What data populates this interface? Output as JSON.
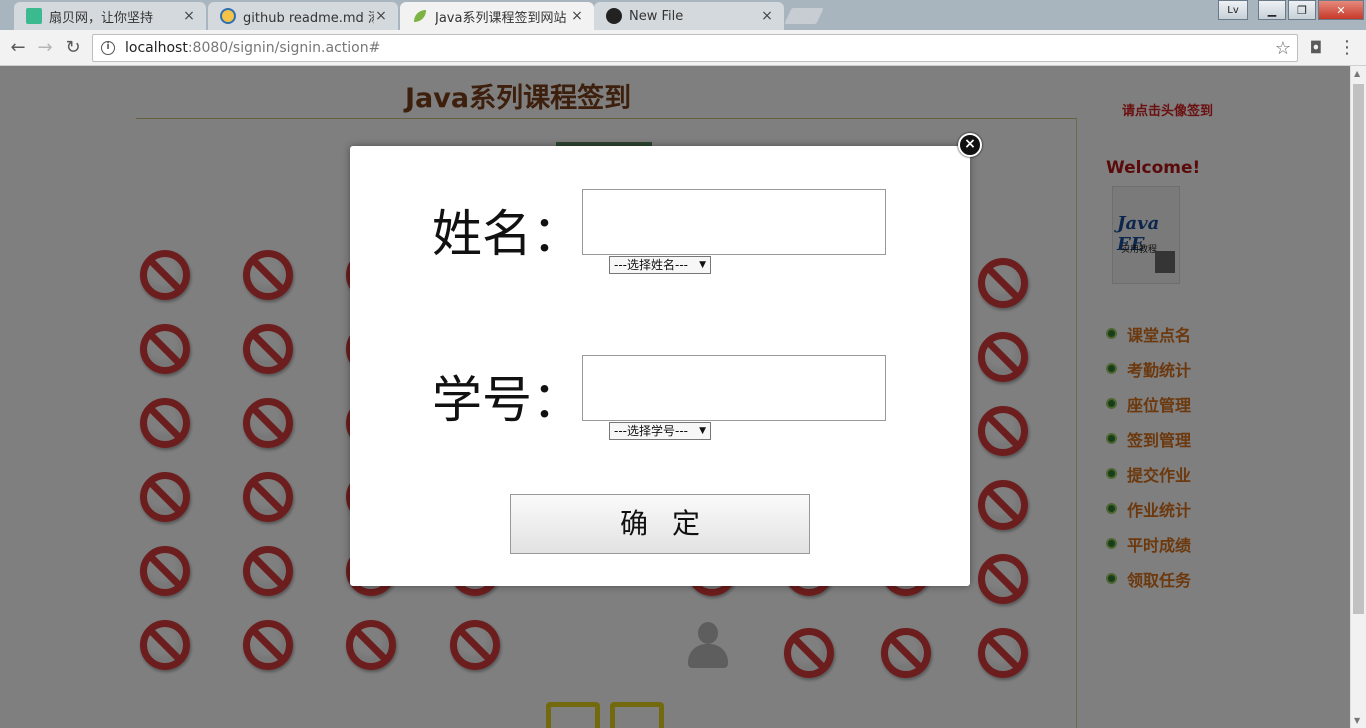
{
  "browser": {
    "tabs": [
      {
        "title": "扇贝网，让你坚持",
        "close": "×"
      },
      {
        "title": "github readme.md 添加",
        "close": "×"
      },
      {
        "title": "Java系列课程签到网站",
        "close": "×"
      },
      {
        "title": "New File",
        "close": "×"
      }
    ],
    "user_badge": "Lv",
    "url_host": "localhost",
    "url_path": ":8080/signin/signin.action#"
  },
  "page": {
    "title": "Java系列课程签到",
    "hint": "请点击头像签到",
    "welcome": "Welcome!",
    "book": {
      "title": "Java EE",
      "subtitle": "实用教程"
    },
    "menu": [
      "课堂点名",
      "考勤统计",
      "座位管理",
      "签到管理",
      "提交作业",
      "作业统计",
      "平时成绩",
      "领取任务"
    ]
  },
  "modal": {
    "name_label": "姓名：",
    "name_value": "",
    "name_select": "---选择姓名---",
    "id_label": "学号：",
    "id_value": "",
    "id_select": "---选择学号---",
    "confirm_label": "确定"
  },
  "colors": {
    "accent_menu": "#d9701a",
    "welcome": "#b51515",
    "hint": "#d62020",
    "title": "#7b3f1a"
  }
}
